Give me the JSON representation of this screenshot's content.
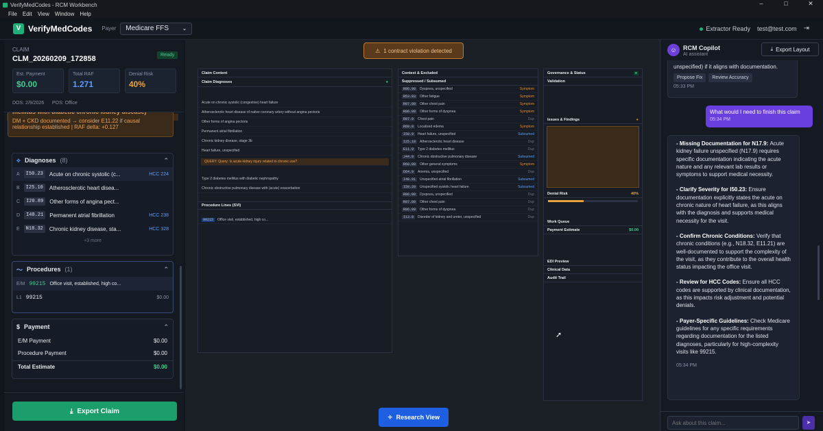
{
  "window": {
    "title": "VerifyMedCodes - RCM Workbench",
    "menu": [
      "File",
      "Edit",
      "View",
      "Window",
      "Help"
    ]
  },
  "header": {
    "brand": "VerifyMedCodes",
    "payer_label": "Payer",
    "payer_value": "Medicare FFS",
    "status": "Extractor Ready",
    "user": "test@test.com"
  },
  "claim": {
    "label": "CLAIM",
    "id": "CLM_20260209_172858",
    "status": "Ready",
    "kpis": [
      {
        "label": "Est. Payment",
        "value": "$0.00",
        "color": "#3ccf8e"
      },
      {
        "label": "Total RAF",
        "value": "1.271",
        "color": "#5a9cff"
      },
      {
        "label": "Denial Risk",
        "value": "40%",
        "color": "#e8a33c"
      }
    ],
    "dos": "DOS: 2/9/2026",
    "pos": "POS: Office"
  },
  "alert": {
    "line1": "mellitus with diabetic chronic kidney disease)",
    "line2": "DM + CKD documented → consider E11.22 if causal",
    "line3": "relationship established | RAF delta: +0.127"
  },
  "diagnoses": {
    "title": "Diagnoses",
    "count": "(8)",
    "more": "+3 more",
    "items": [
      {
        "l": "A",
        "c": "I50.23",
        "d": "Acute on chronic systolic (c...",
        "h": "HCC 224"
      },
      {
        "l": "B",
        "c": "I25.10",
        "d": "Atherosclerotic heart disea...",
        "h": ""
      },
      {
        "l": "C",
        "c": "I20.89",
        "d": "Other forms of angina pect...",
        "h": ""
      },
      {
        "l": "D",
        "c": "I48.21",
        "d": "Permanent atrial fibrillation",
        "h": "HCC 238"
      },
      {
        "l": "E",
        "c": "N18.32",
        "d": "Chronic kidney disease, sta...",
        "h": "HCC 328"
      }
    ]
  },
  "procedures": {
    "title": "Procedures",
    "count": "(1)",
    "em_label": "E/M",
    "em_code": "99215",
    "em_desc": "Office visit, established, high co...",
    "l1_label": "L1",
    "l1_code": "99215",
    "l1_amt": "$0.00"
  },
  "payment": {
    "title": "Payment",
    "rows": [
      {
        "k": "E/M Payment",
        "v": "$0.00"
      },
      {
        "k": "Procedure Payment",
        "v": "$0.00"
      }
    ],
    "total_k": "Total Estimate",
    "total_v": "$0.00"
  },
  "buttons": {
    "export_claim": "Export Claim",
    "research_view": "Research View",
    "export_layout": "Export Layout"
  },
  "violation": "1 contract violation detected",
  "research": {
    "claim_content": "Claim Content",
    "claim_dx": "Claim Diagnoses",
    "proc_title": "Procedure Lines (SVI)",
    "context": "Context & Excluded",
    "suppressed": "Suppressed / Subsumed",
    "governance": "Governance & Status",
    "validation": "Validation",
    "issues": "Issues & Findings",
    "denial": "Denial Risk",
    "work_queue": "Work Queue",
    "payment_est": "Payment Estimate",
    "edi": "EDI Preview",
    "clinical": "Clinical Data",
    "audit": "Audit Trail",
    "query": "QUERY: Query: Is acute kidney injury related to chronic use?",
    "dx_rows": [
      "Acute on chronic systolic (congestive) heart failure",
      "Atherosclerotic heart disease of native coronary artery without angina pectoris",
      "Other forms of angina pectoris",
      "Permanent atrial fibrillation",
      "Chronic kidney disease, stage 3b",
      "Heart failure, unspecified",
      "Type 2 diabetes mellitus with diabetic nephropathy",
      "Chronic obstructive pulmonary disease with (acute) exacerbation"
    ],
    "ctx_rows": [
      [
        "R06.00",
        "Dyspnea, unspecified",
        "Symptom"
      ],
      [
        "R53.83",
        "Other fatigue",
        "Symptom"
      ],
      [
        "R07.89",
        "Other chest pain",
        "Symptom"
      ],
      [
        "R06.09",
        "Other forms of dyspnea",
        "Symptom"
      ],
      [
        "R07.9",
        "Chest pain",
        "Dup"
      ],
      [
        "R60.0",
        "Localized edema",
        "Symptom"
      ],
      [
        "I50.9",
        "Heart failure, unspecified",
        "Subsumed"
      ],
      [
        "I25.10",
        "Atherosclerotic heart disease",
        "Dup"
      ],
      [
        "E11.9",
        "Type 2 diabetes mellitus",
        "Dup"
      ],
      [
        "J44.9",
        "Chronic obstructive pulmonary disease",
        "Subsumed"
      ],
      [
        "R68.89",
        "Other general symptoms",
        "Symptom"
      ],
      [
        "D64.9",
        "Anemia, unspecified",
        "Dup"
      ],
      [
        "I48.91",
        "Unspecified atrial fibrillation",
        "Subsumed"
      ],
      [
        "I50.20",
        "Unspecified systolic heart failure",
        "Subsumed"
      ],
      [
        "R06.00",
        "Dyspnea, unspecified",
        "Dup"
      ],
      [
        "R07.89",
        "Other chest pain",
        "Dup"
      ],
      [
        "R06.09",
        "Other forms of dyspnea",
        "Dup"
      ],
      [
        "I13.0",
        "Disorder of kidney and ureter, unspecified",
        "Dup"
      ]
    ]
  },
  "copilot": {
    "title": "RCM Copilot",
    "sub": "AI assistant",
    "prev_tail": "unspecified) if it aligns with documentation.",
    "chips": [
      "Propose Fix",
      "Review Accuracy"
    ],
    "prev_time": "05:33 PM",
    "user_msg": "What would I need to finish this claim",
    "user_time": "05:34 PM",
    "resp": [
      {
        "h": "- Missing Documentation for N17.9",
        "t": "Acute kidney failure unspecified (N17.9) requires specific documentation indicating the acute nature and any relevant lab results or symptoms to support medical necessity."
      },
      {
        "h": "- Clarify Severity for I50.23",
        "t": "Ensure documentation explicitly states the acute on chronic nature of heart failure, as this aligns with the diagnosis and supports medical necessity for the visit."
      },
      {
        "h": "- Confirm Chronic Conditions",
        "t": "Verify that chronic conditions (e.g., N18.32, E11.21) are well-documented to support the complexity of the visit, as they contribute to the overall health status impacting the office visit."
      },
      {
        "h": "- Review for HCC Codes",
        "t": "Ensure all HCC codes are supported by clinical documentation, as this impacts risk adjustment and potential denials."
      },
      {
        "h": "- Payer-Specific Guidelines",
        "t": "Check Medicare guidelines for any specific requirements regarding documentation for the listed diagnoses, particularly for high-complexity visits like 99215."
      }
    ],
    "resp_time": "05:34 PM",
    "placeholder": "Ask about this claim..."
  }
}
